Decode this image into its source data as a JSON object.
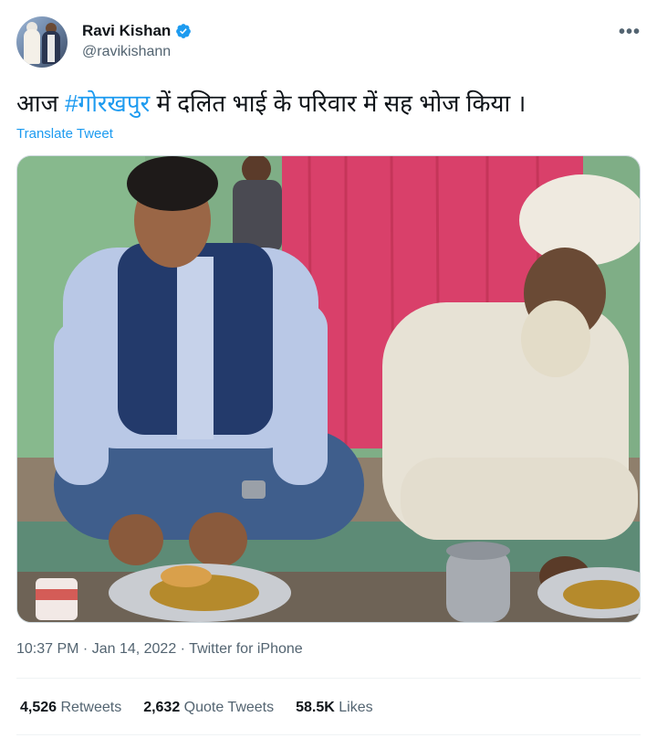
{
  "author": {
    "name": "Ravi Kishan",
    "handle": "@ravikishann",
    "verified_icon": "verified-badge-icon",
    "verified_color": "#1d9bf0"
  },
  "tweet": {
    "text_before": "आज ",
    "hashtag": "#गोरखपुर",
    "text_after": " में दलित भाई के परिवार में सह भोज किया ।",
    "translate_label": "Translate Tweet"
  },
  "meta": {
    "time": "10:37 PM",
    "separator1": " · ",
    "date": "Jan 14, 2022",
    "separator2": " · ",
    "source": "Twitter for iPhone"
  },
  "stats": {
    "retweets_count": "4,526",
    "retweets_label": " Retweets",
    "quotes_count": "2,632",
    "quotes_label": " Quote Tweets",
    "likes_count": "58.5K",
    "likes_label": " Likes"
  },
  "colors": {
    "link": "#1d9bf0",
    "secondary_text": "#536471",
    "primary_text": "#0f1419"
  }
}
